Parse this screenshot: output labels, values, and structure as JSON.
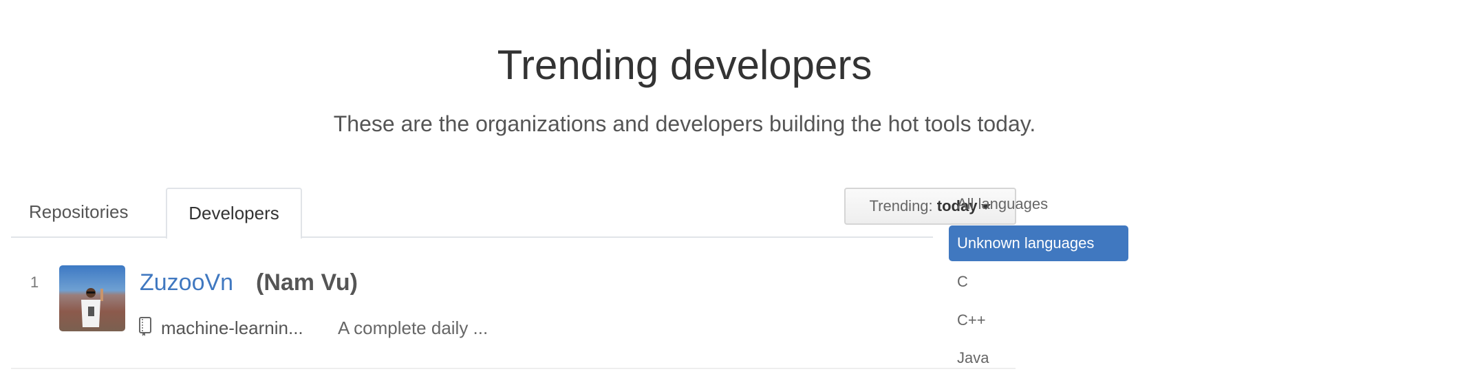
{
  "header": {
    "title": "Trending developers",
    "subtitle": "These are the organizations and developers building the hot tools today."
  },
  "tabs": [
    {
      "label": "Repositories",
      "active": false
    },
    {
      "label": "Developers",
      "active": true
    }
  ],
  "trending": {
    "label": "Trending:",
    "value": "today",
    "icon": "caret-down-icon"
  },
  "developers": [
    {
      "rank": "1",
      "login": "ZuzooVn",
      "name": "(Nam Vu)",
      "repo_icon": "book-icon",
      "repo": "machine-learnin...",
      "description": "A complete daily ..."
    }
  ],
  "languages": {
    "items": [
      {
        "label": "All languages"
      },
      {
        "label": "Unknown languages",
        "selected": true
      },
      {
        "label": "C"
      },
      {
        "label": "C++"
      },
      {
        "label": "Java"
      }
    ],
    "selected_color": "#4078c0"
  },
  "colors": {
    "link": "#4078c0"
  }
}
